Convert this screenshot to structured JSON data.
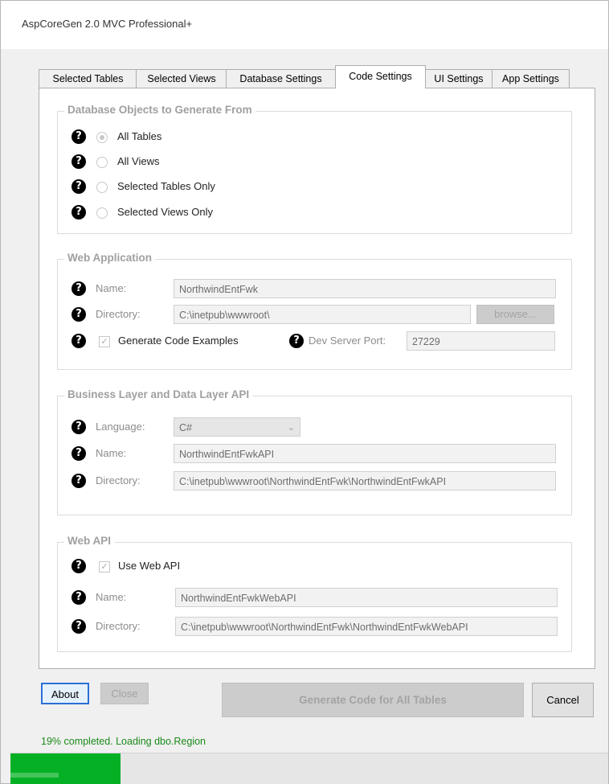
{
  "window": {
    "title": "AspCoreGen 2.0 MVC Professional+"
  },
  "tabs": [
    {
      "label": "Selected Tables"
    },
    {
      "label": "Selected Views"
    },
    {
      "label": "Database Settings"
    },
    {
      "label": "Code Settings",
      "active": true
    },
    {
      "label": "UI Settings"
    },
    {
      "label": "App Settings"
    }
  ],
  "db_objects": {
    "title": "Database Objects to Generate From",
    "options": [
      {
        "label": "All Tables",
        "selected": true
      },
      {
        "label": "All Views",
        "selected": false
      },
      {
        "label": "Selected Tables Only",
        "selected": false
      },
      {
        "label": "Selected Views Only",
        "selected": false
      }
    ]
  },
  "web_app": {
    "title": "Web Application",
    "name_label": "Name:",
    "name_value": "NorthwindEntFwk",
    "directory_label": "Directory:",
    "directory_value": "C:\\inetpub\\wwwroot\\",
    "browse_label": "browse...",
    "generate_examples_label": "Generate Code Examples",
    "generate_examples_checked": true,
    "dev_port_label": "Dev Server Port:",
    "dev_port_value": "27229"
  },
  "business_layer": {
    "title": "Business Layer and Data Layer API",
    "language_label": "Language:",
    "language_value": "C#",
    "name_label": "Name:",
    "name_value": "NorthwindEntFwkAPI",
    "directory_label": "Directory:",
    "directory_value": "C:\\inetpub\\wwwroot\\NorthwindEntFwk\\NorthwindEntFwkAPI"
  },
  "web_api": {
    "title": "Web API",
    "use_label": "Use Web API",
    "use_checked": true,
    "name_label": "Name:",
    "name_value": "NorthwindEntFwkWebAPI",
    "directory_label": "Directory:",
    "directory_value": "C:\\inetpub\\wwwroot\\NorthwindEntFwk\\NorthwindEntFwkWebAPI"
  },
  "footer": {
    "about_label": "About",
    "close_label": "Close",
    "generate_label": "Generate Code for All Tables",
    "cancel_label": "Cancel"
  },
  "status": {
    "text": "19% completed.  Loading dbo.Region",
    "progress_fraction": 0.184,
    "color": "#06b025"
  },
  "icons": {
    "help": "help-icon"
  }
}
